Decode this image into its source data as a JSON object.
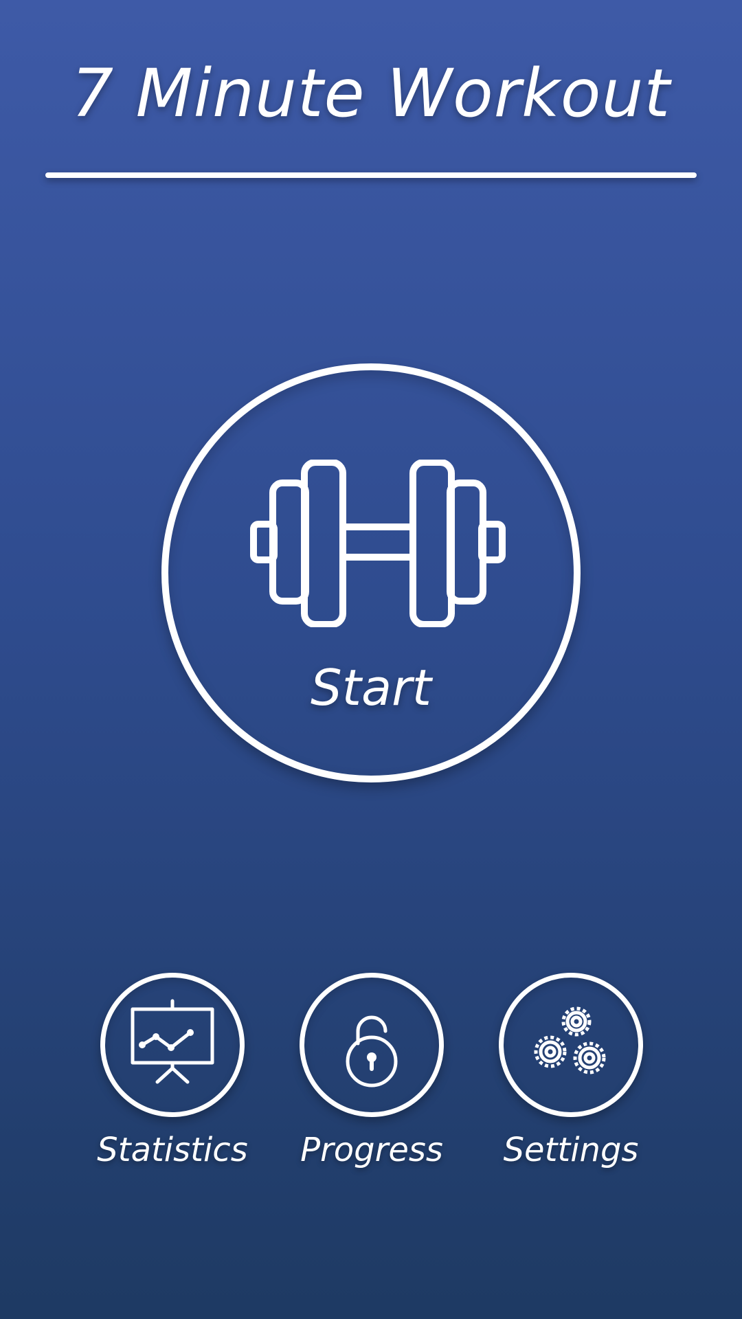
{
  "app": {
    "title": "7 Minute Workout"
  },
  "main": {
    "start_label": "Start",
    "start_icon": "dumbbell-icon"
  },
  "nav": {
    "items": [
      {
        "label": "Statistics",
        "icon": "chart-presentation-icon"
      },
      {
        "label": "Progress",
        "icon": "unlocked-padlock-icon"
      },
      {
        "label": "Settings",
        "icon": "gears-icon"
      }
    ]
  },
  "colors": {
    "background_top": "#3e5aa7",
    "background_bottom": "#1e3a63",
    "foreground": "#ffffff"
  }
}
